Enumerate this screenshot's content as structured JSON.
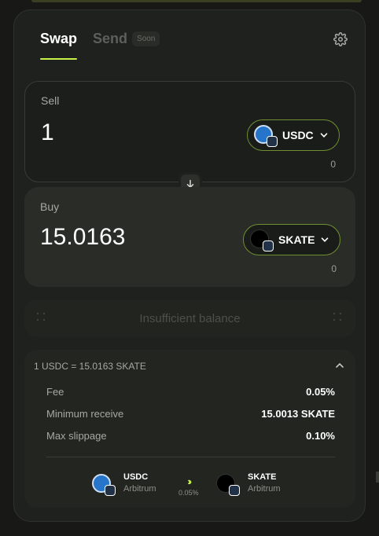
{
  "tabs": {
    "swap_label": "Swap",
    "send_label": "Send",
    "soon_badge": "Soon"
  },
  "sell": {
    "label": "Sell",
    "amount": "1",
    "token": "USDC",
    "balance": "0"
  },
  "buy": {
    "label": "Buy",
    "amount": "15.0163",
    "token": "SKATE",
    "balance": "0"
  },
  "action": {
    "label": "Insufficient balance"
  },
  "details": {
    "rate": "1 USDC = 15.0163 SKATE",
    "rows": [
      {
        "key": "Fee",
        "value": "0.05%"
      },
      {
        "key": "Minimum receive",
        "value": "15.0013 SKATE"
      },
      {
        "key": "Max slippage",
        "value": "0.10%"
      }
    ],
    "route": {
      "from_symbol": "USDC",
      "from_network": "Arbitrum",
      "fee": "0.05%",
      "to_symbol": "SKATE",
      "to_network": "Arbitrum"
    }
  },
  "colors": {
    "accent": "#c6f24a",
    "usdc": "#2775ca"
  },
  "icons": [
    "gear-icon",
    "chevron-down-icon",
    "arrow-down-icon",
    "chevron-up-icon",
    "double-chevron-right-icon",
    "usdc-token-icon",
    "skate-token-icon",
    "arbitrum-badge-icon"
  ]
}
